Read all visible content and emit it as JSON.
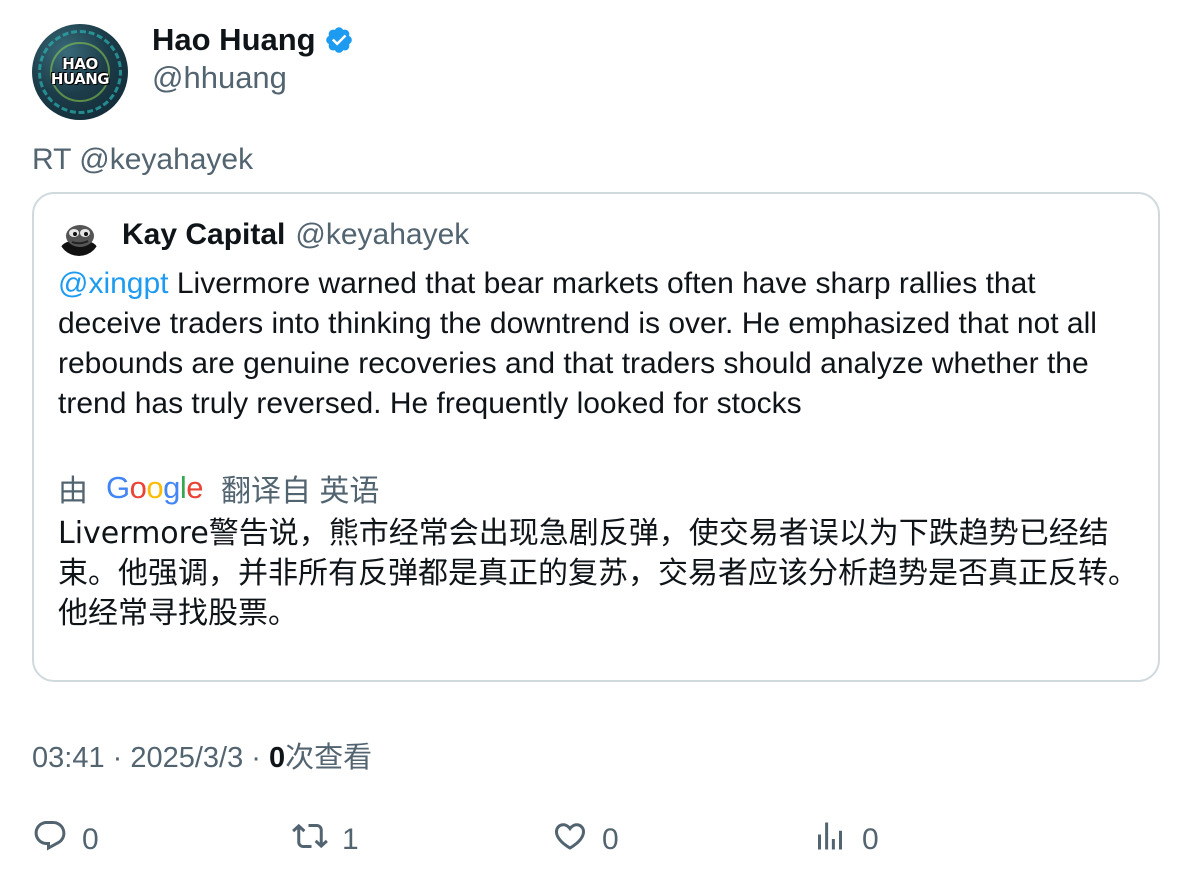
{
  "author": {
    "display_name": "Hao Huang",
    "handle": "@hhuang",
    "avatar_text_line1": "HAO",
    "avatar_text_line2": "HUANG",
    "verified_color": "#1d9bf0"
  },
  "retweet_line": "RT @keyahayek",
  "quoted_tweet": {
    "display_name": "Kay Capital",
    "handle": "@keyahayek",
    "mention": "@xingpt",
    "body": " Livermore warned that bear markets often have sharp rallies that deceive traders into thinking the downtrend is over. He emphasized that not all rebounds are genuine recoveries and that traders should analyze whether the trend has truly reversed. He frequently looked for stocks",
    "translate_prefix": "由",
    "translate_suffix": "翻译自 英语",
    "google_letters": [
      "G",
      "o",
      "o",
      "g",
      "l",
      "e"
    ],
    "translation": "Livermore警告说，熊市经常会出现急剧反弹，使交易者误以为下跌趋势已经结束。他强调，并非所有反弹都是真正的复苏，交易者应该分析趋势是否真正反转。他经常寻找股票。"
  },
  "meta": {
    "time": "03:41",
    "separator": " · ",
    "date": "2025/3/3",
    "views_count": "0",
    "views_label": "次查看"
  },
  "actions": {
    "reply_count": "0",
    "retweet_count": "1",
    "like_count": "0",
    "views_count": "0"
  },
  "colors": {
    "link": "#1d9bf0",
    "secondary_text": "#536471",
    "border": "#cfd9de"
  }
}
